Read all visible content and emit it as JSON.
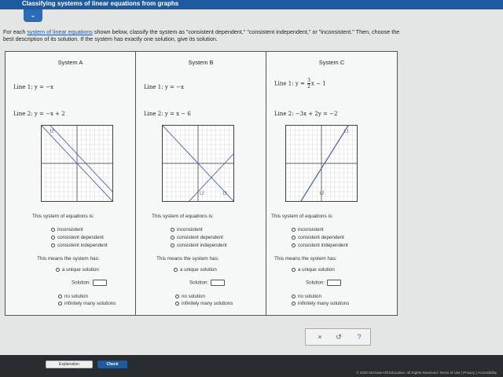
{
  "header": {
    "title": "Classifying systems of linear equations from graphs",
    "collapse_icon": "chevron-down-icon"
  },
  "instructions": {
    "prefix": "For each ",
    "link": "system of linear equations",
    "rest_line1": " shown below, classify the system as \"consistent dependent,\" \"consistent independent,\" or \"inconsistent.\" Then, choose the",
    "line2": "best description of its solution. If the system has exactly one solution, give its solution."
  },
  "question_label": "This system of equations is:",
  "means_label": "This means the system has:",
  "classification_options": [
    "inconsistent",
    "consistent dependent",
    "consistent independent"
  ],
  "solution_options": {
    "unique": "a unique solution",
    "solution_label": "Solution:",
    "none": "no solution",
    "infinite": "infinitely many solutions"
  },
  "systems": [
    {
      "title": "System A",
      "line1_label": "Line 1:",
      "line1_eq": "y = −x",
      "line2_label": "Line 2:",
      "line2_eq": "y = −x + 2",
      "graph_labels": [
        "12"
      ]
    },
    {
      "title": "System B",
      "line1_label": "Line 1:",
      "line1_eq": "y = −x",
      "line2_label": "Line 2:",
      "line2_eq": "y = x − 6",
      "graph_labels": [
        "L2",
        "L1"
      ]
    },
    {
      "title": "System C",
      "line1_label": "Line 1:",
      "line1_eq_prefix": "y = ",
      "line1_frac_num": "3",
      "line1_frac_den": "2",
      "line1_eq_suffix": "x − 1",
      "line2_label": "Line 2:",
      "line2_eq": "−3x + 2y = −2",
      "graph_labels": [
        "L1",
        "L2"
      ]
    }
  ],
  "actions": {
    "clear": "×",
    "undo": "↺",
    "help": "?"
  },
  "bottom": {
    "explanation": "Explanation",
    "check": "Check",
    "footer": "© 2020 McGraw-Hill Education. All Rights Reserved.   Terms of Use   |   Privacy   |   Accessibility"
  },
  "colors": {
    "brand": "#1e5aa0",
    "line_color": "#4a5fb0"
  }
}
